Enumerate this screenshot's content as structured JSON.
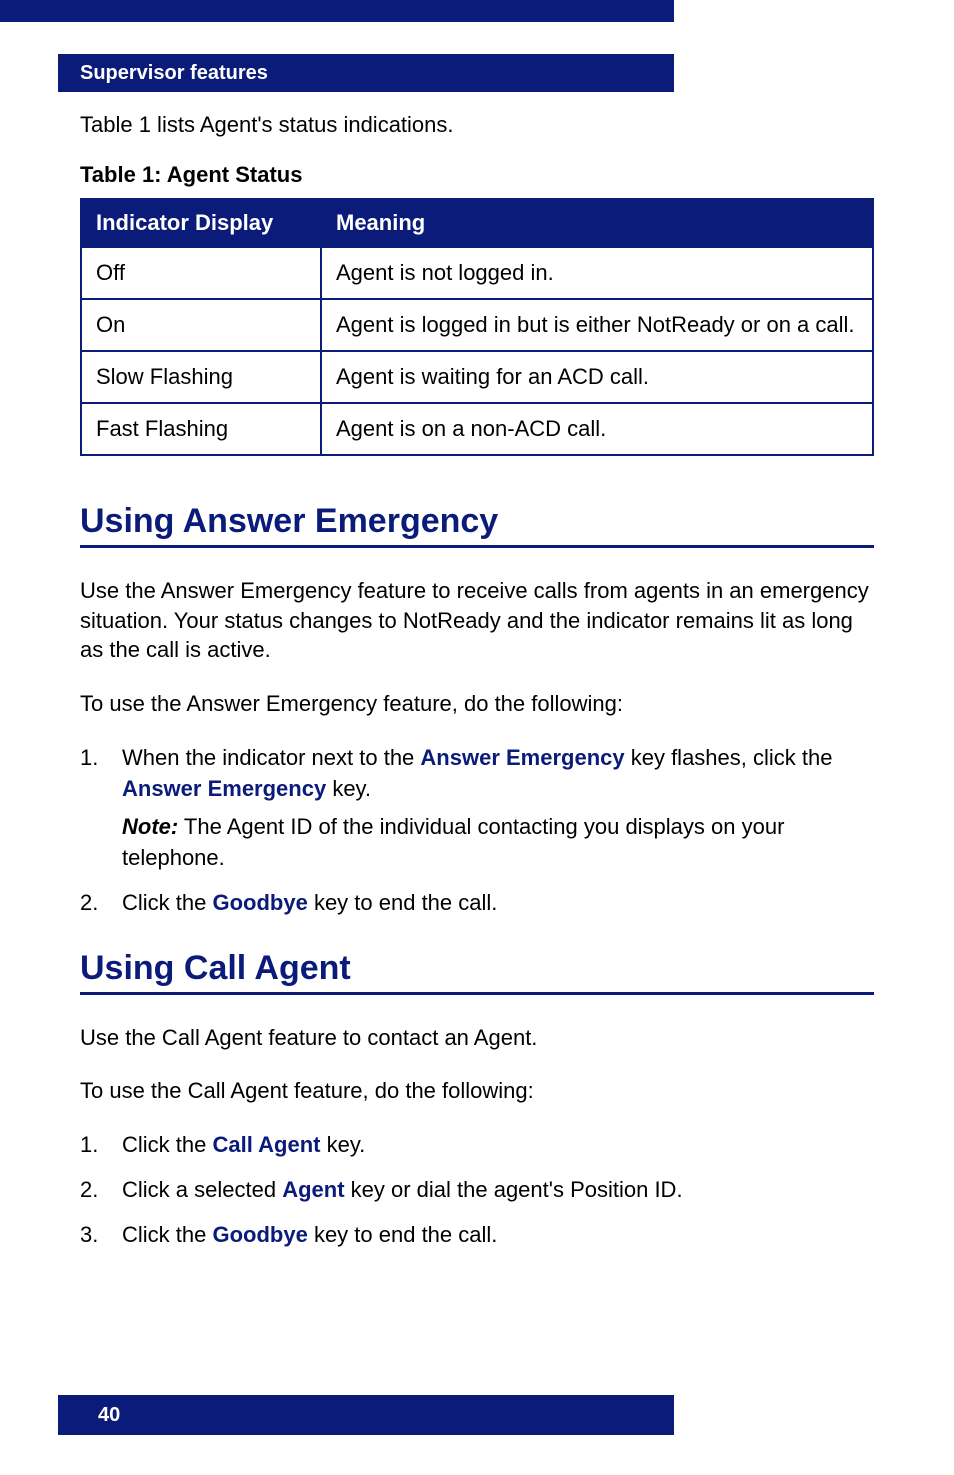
{
  "header": {
    "title": "Supervisor features"
  },
  "intro": "Table 1 lists Agent's status indications.",
  "table": {
    "caption": "Table 1: Agent Status",
    "columns": [
      "Indicator Display",
      "Meaning"
    ],
    "rows": [
      {
        "indicator": "Off",
        "meaning": "Agent is not logged in."
      },
      {
        "indicator": "On",
        "meaning": "Agent is logged in but is either NotReady or on a call."
      },
      {
        "indicator": "Slow Flashing",
        "meaning": "Agent is waiting for an ACD call."
      },
      {
        "indicator": "Fast Flashing",
        "meaning": "Agent is on a non-ACD call."
      }
    ]
  },
  "section1": {
    "heading": "Using Answer Emergency",
    "para1": "Use the Answer Emergency feature to receive calls from agents in an emergency situation. Your status changes to NotReady and the indicator remains lit as long as the call is active.",
    "para2": "To use the Answer Emergency feature, do the following:",
    "step1_a": "When the indicator next to the ",
    "step1_kw1": "Answer Emergency",
    "step1_b": " key flashes, click the ",
    "step1_kw2": "Answer Emergency",
    "step1_c": " key.",
    "note_label": "Note:",
    "note_text": " The Agent ID of the individual contacting you displays on your telephone.",
    "step2_a": "Click the ",
    "step2_kw": "Goodbye",
    "step2_b": " key to end the call."
  },
  "section2": {
    "heading": "Using Call Agent",
    "para1": "Use the Call Agent feature to contact an Agent.",
    "para2": "To use the Call Agent feature, do the following:",
    "step1_a": "Click the ",
    "step1_kw": "Call Agent",
    "step1_b": " key.",
    "step2_a": "Click a selected ",
    "step2_kw": "Agent",
    "step2_b": " key or dial the agent's Position ID.",
    "step3_a": "Click the ",
    "step3_kw": "Goodbye",
    "step3_b": " key to end the call."
  },
  "footer": {
    "page_number": "40"
  }
}
